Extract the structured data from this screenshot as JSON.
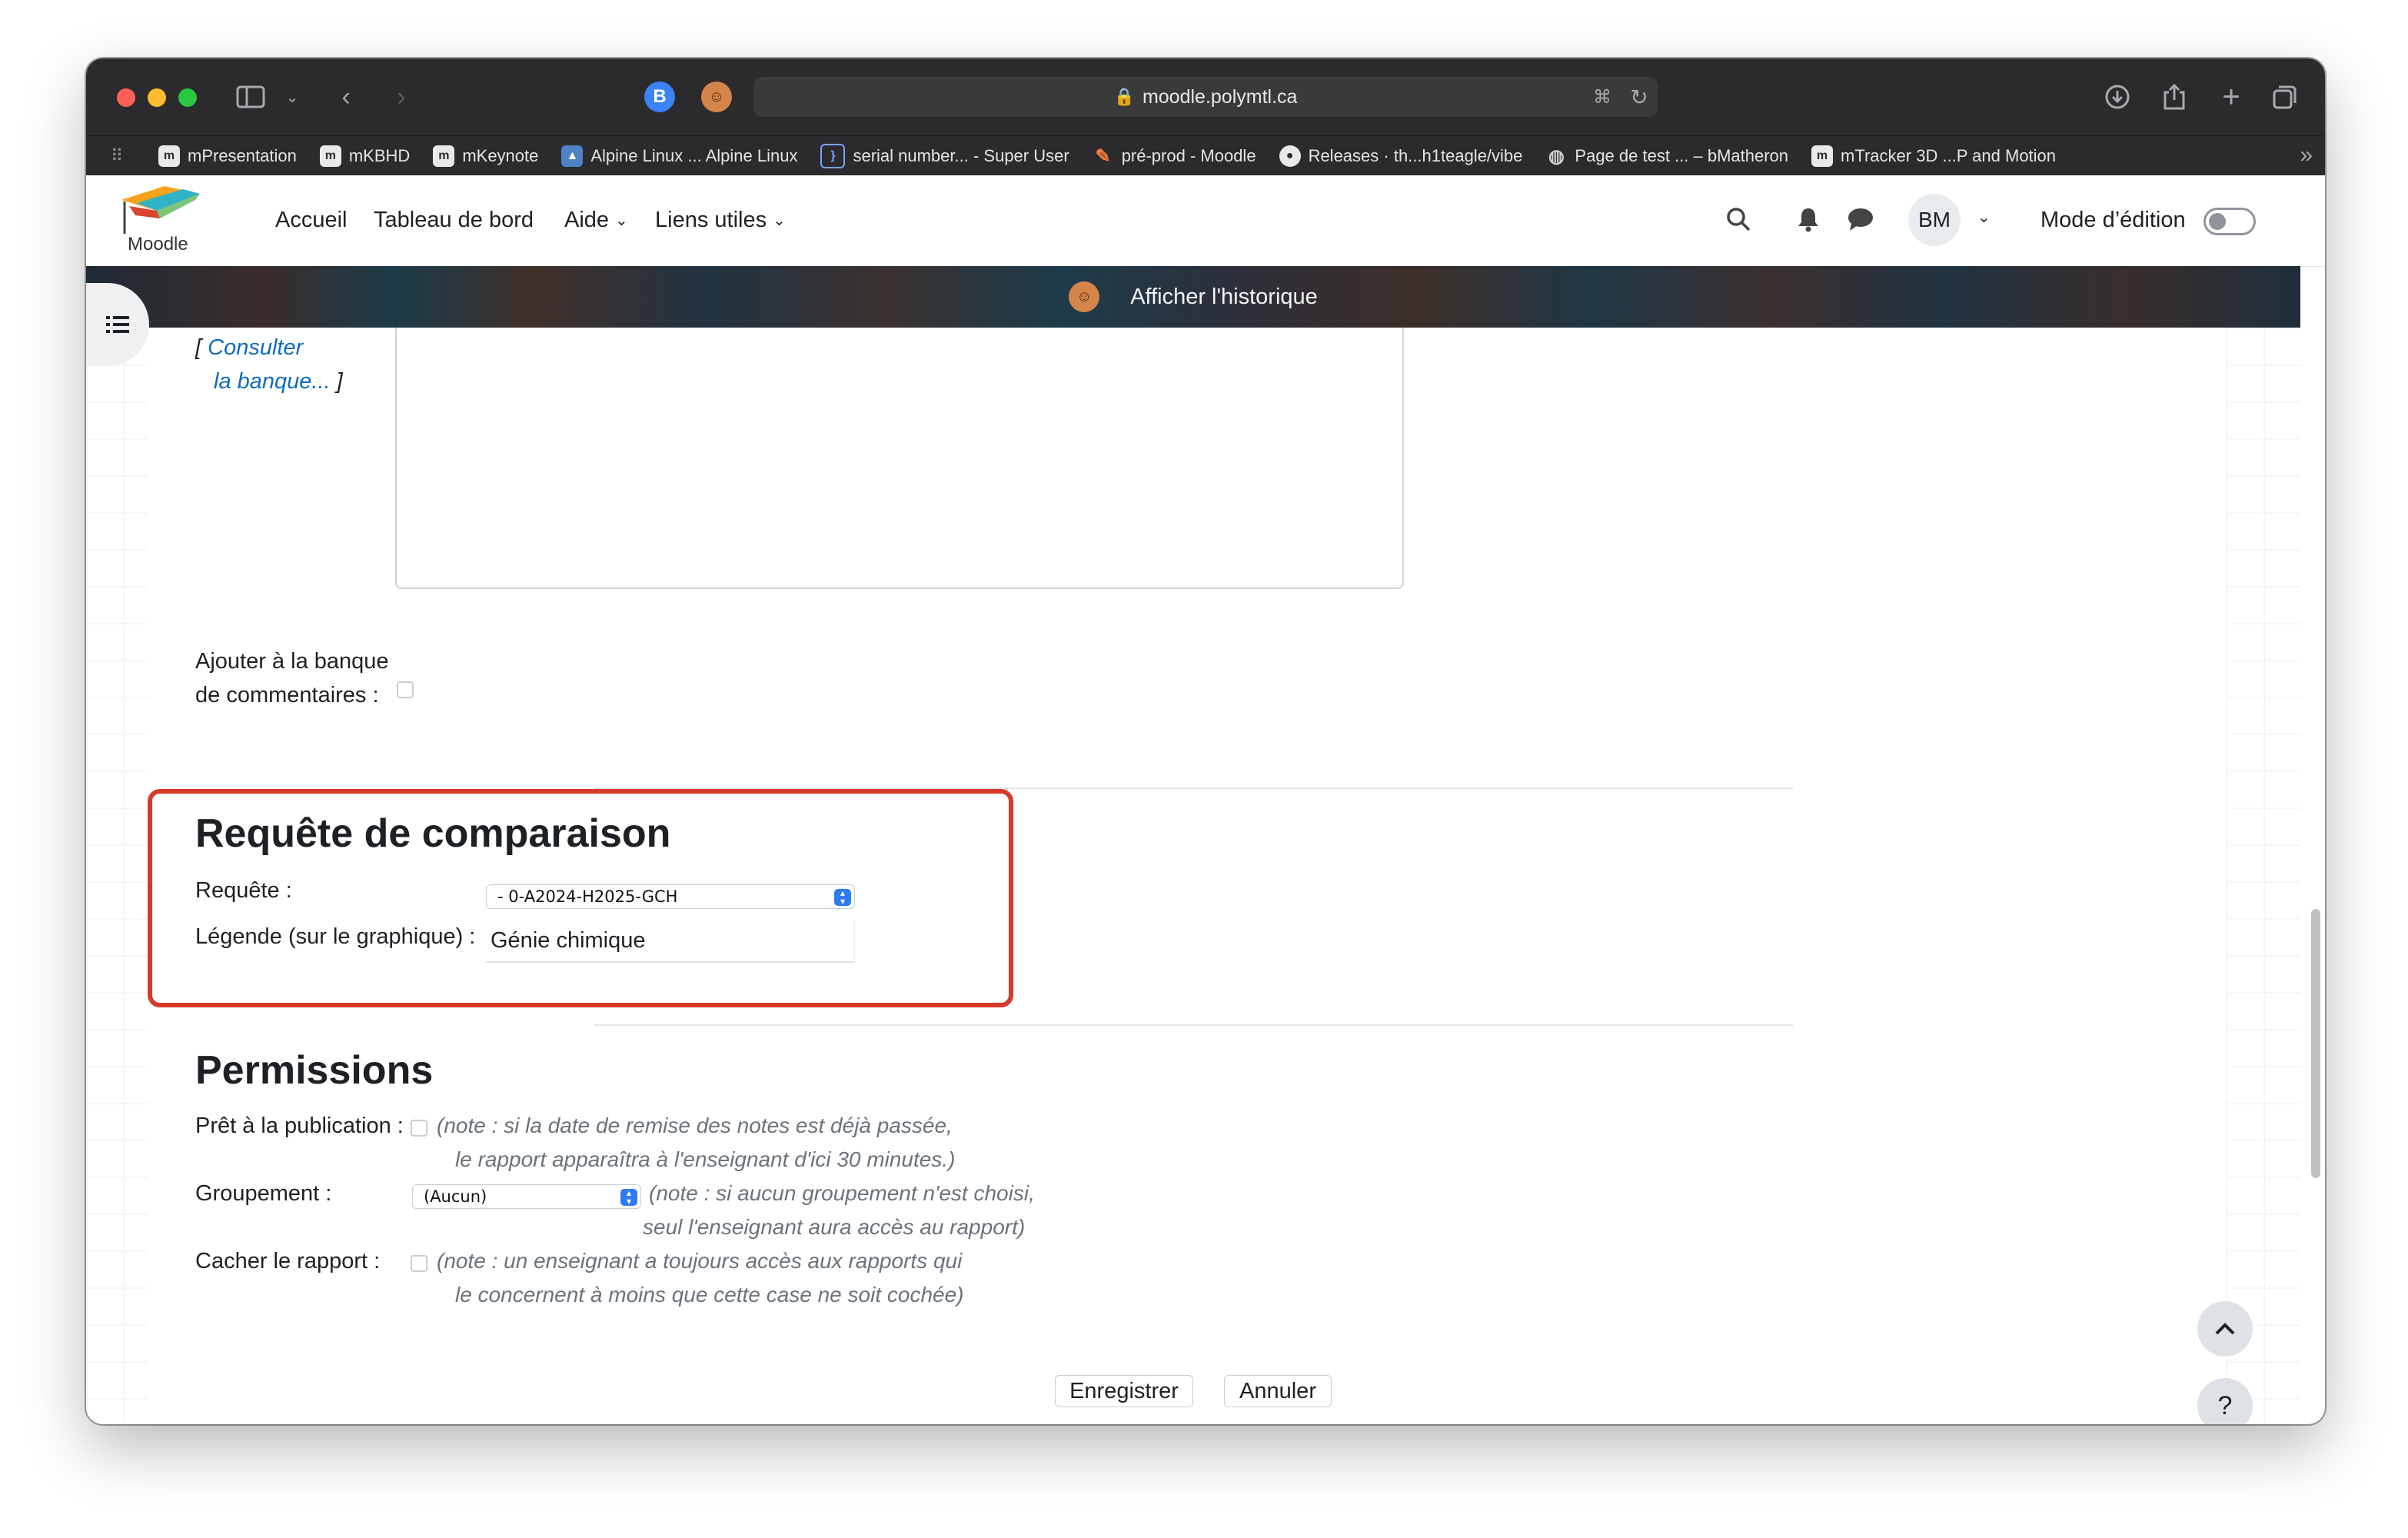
{
  "browser": {
    "url": "moodle.polymtl.ca",
    "extension_b_label": "B",
    "bookmarks": [
      {
        "label": "mPresentation",
        "icon": "m-icon"
      },
      {
        "label": "mKBHD",
        "icon": "m-icon"
      },
      {
        "label": "mKeynote",
        "icon": "m-icon"
      },
      {
        "label": "Alpine Linux ... Alpine Linux",
        "icon": "mountain-icon"
      },
      {
        "label": "serial number... - Super User",
        "icon": "brace-icon"
      },
      {
        "label": "pré-prod - Moodle",
        "icon": "feather-icon"
      },
      {
        "label": "Releases · th...h1teagle/vibe",
        "icon": "github-icon"
      },
      {
        "label": "Page de test ... – bMatheron",
        "icon": "globe-icon"
      },
      {
        "label": "mTracker 3D ...P and Motion",
        "icon": "m-icon"
      }
    ]
  },
  "navbar": {
    "logo_text": "Moodle",
    "items": [
      {
        "label": "Accueil"
      },
      {
        "label": "Tableau de bord"
      },
      {
        "label": "Aide"
      },
      {
        "label": "Liens utiles"
      }
    ],
    "user_initials": "BM",
    "edit_mode_label": "Mode d’édition"
  },
  "banner": {
    "label": "Afficher l'historique"
  },
  "form": {
    "consult_link_prefix": "[",
    "consult_link_line1": "Consulter",
    "consult_link_line2": "la banque...",
    "consult_link_suffix": "]",
    "add_to_bank_line1": "Ajouter à la banque",
    "add_to_bank_line2": "de commentaires :",
    "comparison": {
      "heading": "Requête de comparaison",
      "query_label": "Requête :",
      "query_value": "- 0-A2024-H2025-GCH",
      "legend_label": "Légende (sur le graphique) :",
      "legend_value": "Génie chimique"
    },
    "permissions": {
      "heading": "Permissions",
      "ready_label": "Prêt à la publication :",
      "ready_note_line1": "(note : si la date de remise des notes est déjà passée,",
      "ready_note_line2": "le rapport apparaîtra à l'enseignant d'ici 30 minutes.)",
      "grouping_label": "Groupement :",
      "grouping_value": "(Aucun)",
      "grouping_note_line1": "(note : si aucun groupement n'est choisi,",
      "grouping_note_line2": "seul l'enseignant aura accès au rapport)",
      "hide_label": "Cacher le rapport :",
      "hide_note_line1": "(note : un enseignant a toujours accès aux rapports qui",
      "hide_note_line2": "le concernent à moins que cette case ne soit cochée)"
    },
    "save_label": "Enregistrer",
    "cancel_label": "Annuler"
  },
  "help_label": "?",
  "colors": {
    "link": "#0f6cbf",
    "highlight_border": "#d63a2a",
    "select_arrow": "#2f7bf5"
  }
}
